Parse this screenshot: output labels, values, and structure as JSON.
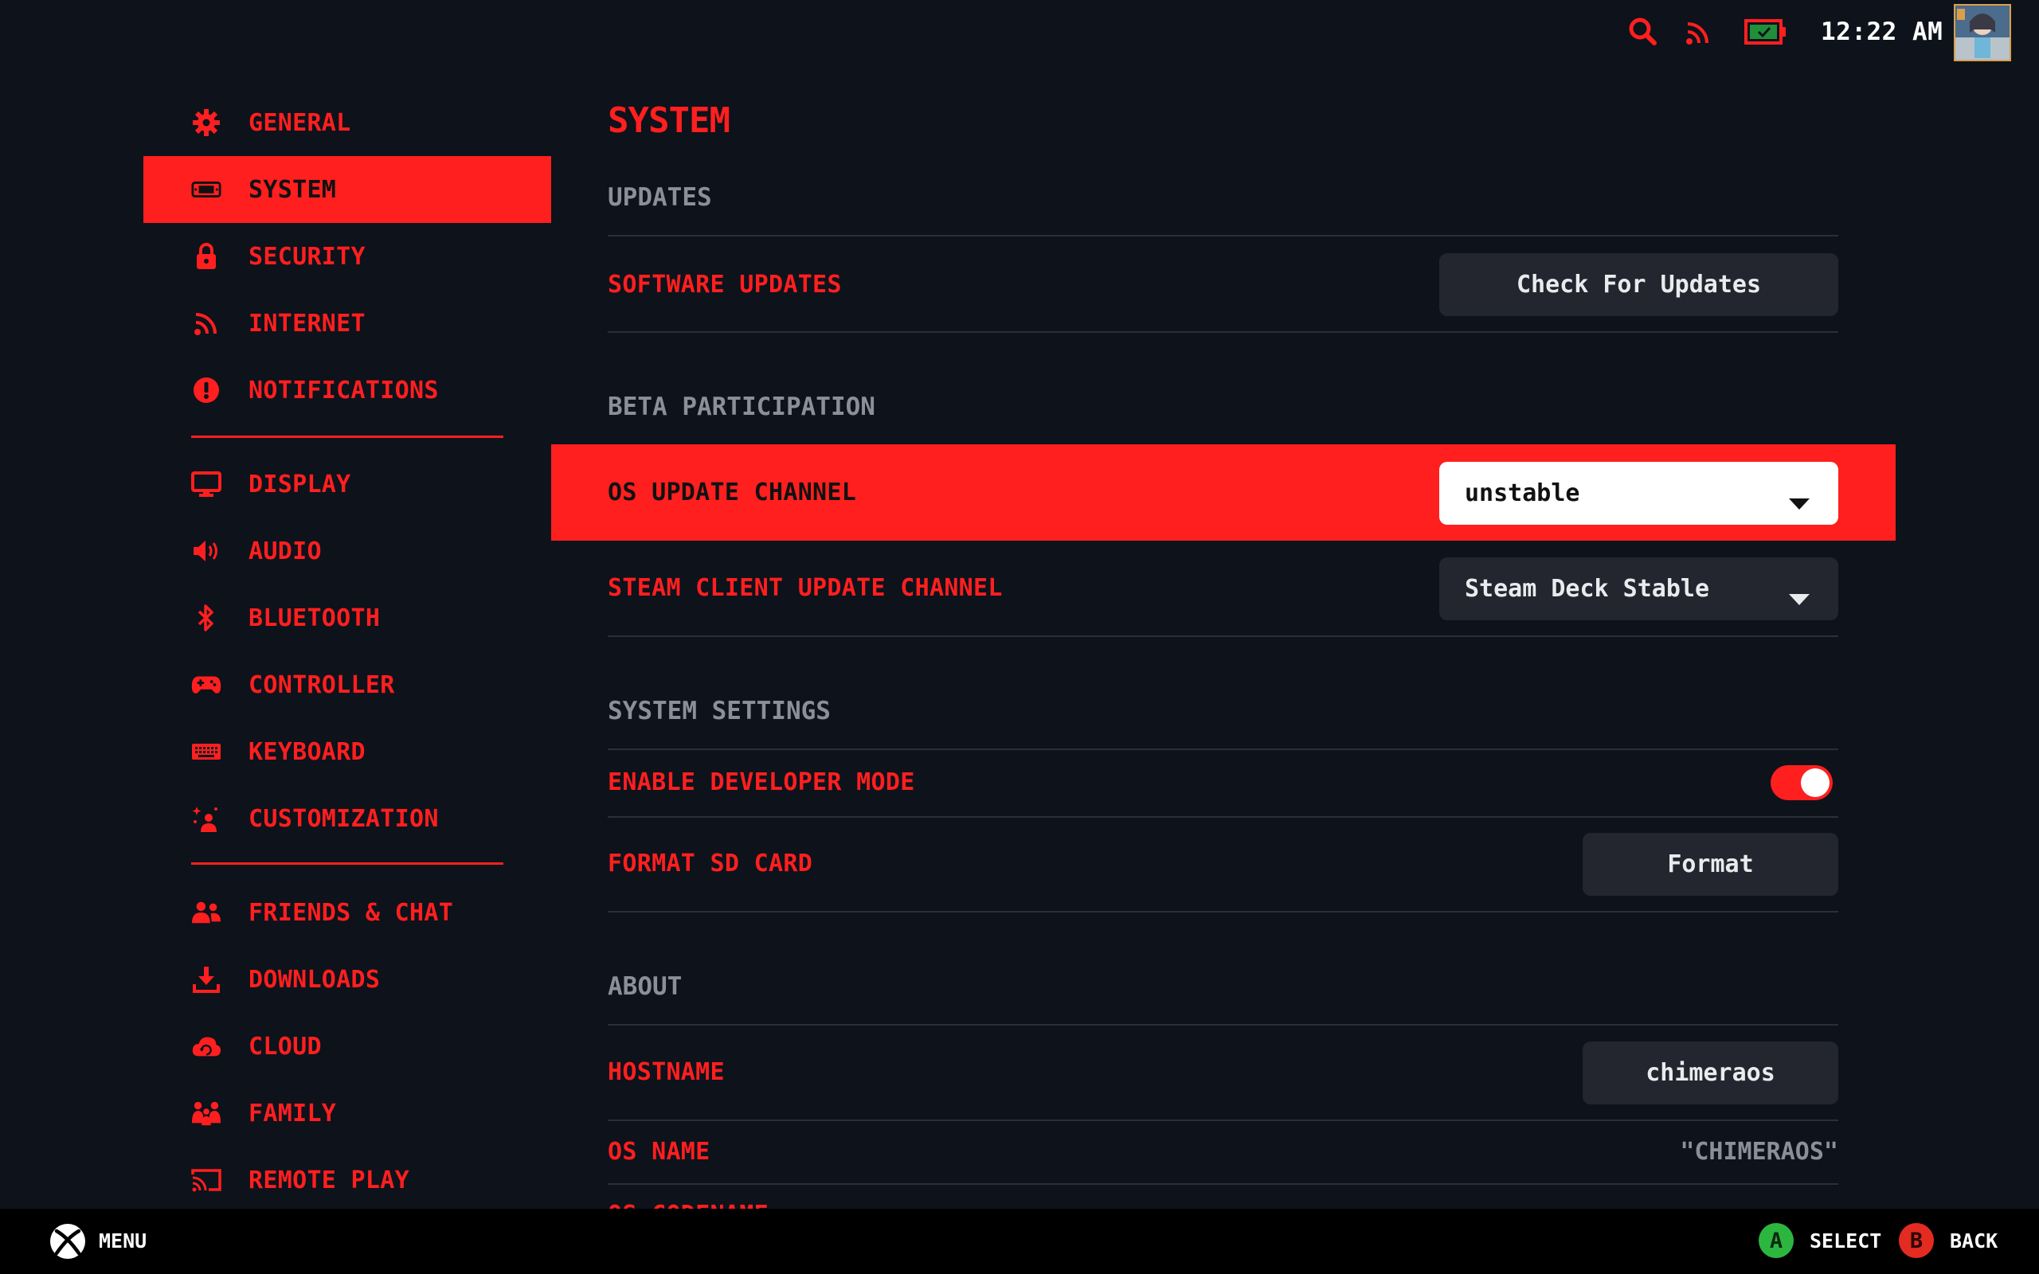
{
  "status_bar": {
    "time": "12:22 AM",
    "icons": [
      "search-icon",
      "wifi-icon",
      "battery-icon"
    ],
    "battery_color": "#1f8f3a"
  },
  "sidebar": {
    "items": [
      {
        "label": "GENERAL",
        "icon": "gear-icon"
      },
      {
        "label": "SYSTEM",
        "icon": "system-icon",
        "active": true
      },
      {
        "label": "SECURITY",
        "icon": "lock-icon"
      },
      {
        "label": "INTERNET",
        "icon": "wifi-icon"
      },
      {
        "label": "NOTIFICATIONS",
        "icon": "alert-icon"
      },
      {
        "label": "DISPLAY",
        "icon": "monitor-icon"
      },
      {
        "label": "AUDIO",
        "icon": "speaker-icon"
      },
      {
        "label": "BLUETOOTH",
        "icon": "bluetooth-icon"
      },
      {
        "label": "CONTROLLER",
        "icon": "gamepad-icon"
      },
      {
        "label": "KEYBOARD",
        "icon": "keyboard-icon"
      },
      {
        "label": "CUSTOMIZATION",
        "icon": "sparkle-person-icon"
      },
      {
        "label": "FRIENDS & CHAT",
        "icon": "friends-icon"
      },
      {
        "label": "DOWNLOADS",
        "icon": "download-icon"
      },
      {
        "label": "CLOUD",
        "icon": "cloud-icon"
      },
      {
        "label": "FAMILY",
        "icon": "family-icon"
      },
      {
        "label": "REMOTE PLAY",
        "icon": "cast-icon"
      }
    ]
  },
  "main": {
    "title": "SYSTEM",
    "sections": {
      "updates": {
        "title": "UPDATES",
        "software_updates_label": "SOFTWARE UPDATES",
        "check_button": "Check For Updates"
      },
      "beta": {
        "title": "BETA PARTICIPATION",
        "os_channel_label": "OS UPDATE CHANNEL",
        "os_channel_value": "unstable",
        "steam_channel_label": "STEAM CLIENT UPDATE CHANNEL",
        "steam_channel_value": "Steam Deck Stable"
      },
      "system_settings": {
        "title": "SYSTEM SETTINGS",
        "dev_mode_label": "ENABLE DEVELOPER MODE",
        "dev_mode_enabled": true,
        "format_sd_label": "FORMAT SD CARD",
        "format_button": "Format"
      },
      "about": {
        "title": "ABOUT",
        "hostname_label": "HOSTNAME",
        "hostname_value": "chimeraos",
        "os_name_label": "OS NAME",
        "os_name_value": "\"CHIMERAOS\"",
        "os_codename_label": "OS CODENAME"
      }
    }
  },
  "bottom_bar": {
    "menu_label": "MENU",
    "select_key": "A",
    "select_label": "SELECT",
    "back_key": "B",
    "back_label": "BACK",
    "colors": {
      "a_button": "#2db63f",
      "b_button": "#e32b22"
    }
  }
}
